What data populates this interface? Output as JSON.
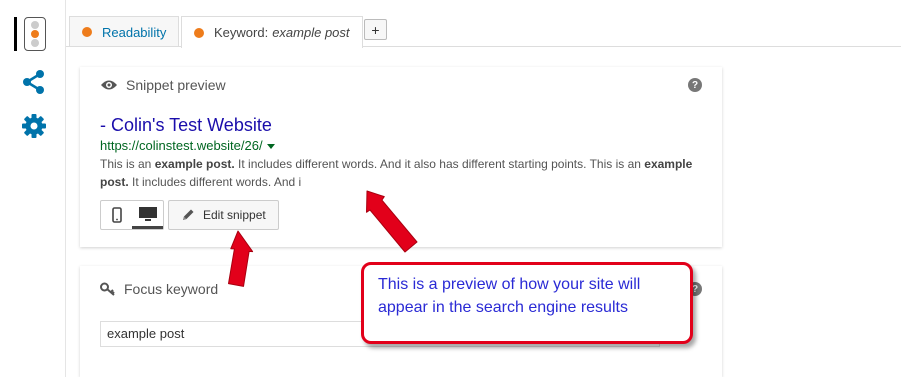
{
  "tabs": [
    {
      "label": "Readability"
    },
    {
      "label": "Keyword:",
      "value": "example post"
    }
  ],
  "add_tab_label": "+",
  "snippet": {
    "header": "Snippet preview",
    "title": "- Colin's Test Website",
    "url": "https://colinstest.website/26/",
    "desc_parts": [
      "This is an ",
      "example post.",
      " It includes different words. And it also has different starting points. This is an ",
      "example post.",
      " It includes different words. And i"
    ],
    "edit_label": "Edit snippet"
  },
  "focus": {
    "header": "Focus keyword",
    "value": "example post"
  },
  "help_label": "?",
  "callout_text": "This is a preview of how your site will appear in the search engine results",
  "colors": {
    "accent": "#ee7c1b",
    "link": "#1a0dab",
    "url": "#006621",
    "callout_border": "#e2001a"
  }
}
